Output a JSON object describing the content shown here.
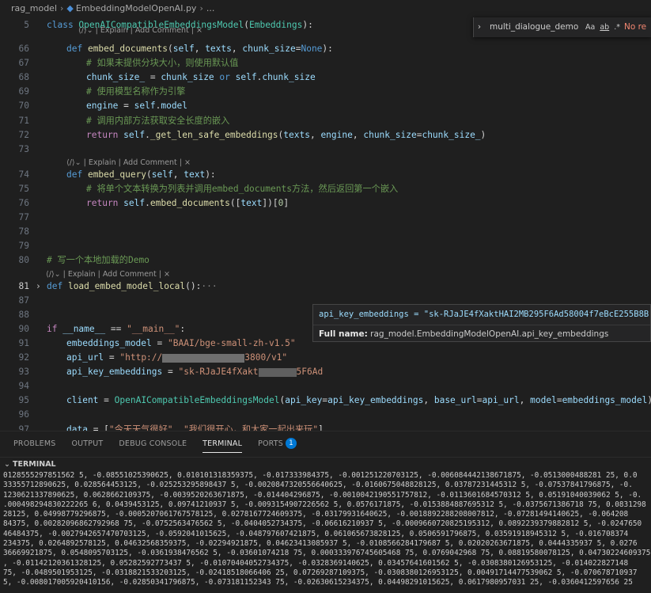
{
  "breadcrumb": {
    "folder": "rag_model",
    "file": "EmbeddingModelOpenAI.py",
    "rest": "..."
  },
  "find_widget": {
    "query": "multi_dialogue_demo",
    "match_case": "Aa",
    "whole_word": "ab",
    "regex": ".*",
    "result": "No re"
  },
  "codelens": {
    "top": "| Explain | Add Comment | ×",
    "l74": "| Explain | Add Comment | ×",
    "l81": "| Explain | Add Comment | ×"
  },
  "code": {
    "l5": [
      "5",
      "class ",
      "OpenAICompatibleEmbeddingsModel",
      "(",
      "Embeddings",
      "):"
    ],
    "l66": [
      "66",
      "def ",
      "embed_documents",
      "(",
      "self",
      ", ",
      "texts",
      ", ",
      "chunk_size",
      "=",
      "None",
      "):"
    ],
    "l67": [
      "67",
      "# 如果未提供分块大小，则使用默认值"
    ],
    "l68": [
      "68",
      "chunk_size_",
      " = ",
      "chunk_size",
      " or ",
      "self",
      ".",
      "chunk_size"
    ],
    "l69": [
      "69",
      "# 使用模型名称作为引擎"
    ],
    "l70": [
      "70",
      "engine",
      " = ",
      "self",
      ".",
      "model"
    ],
    "l71": [
      "71",
      "# 调用内部方法获取安全长度的嵌入"
    ],
    "l72": [
      "72",
      "return ",
      "self",
      ".",
      "_get_len_safe_embeddings",
      "(",
      "texts",
      ", ",
      "engine",
      ", ",
      "chunk_size",
      "=",
      "chunk_size_",
      ")"
    ],
    "l73": [
      "73"
    ],
    "l74": [
      "74",
      "def ",
      "embed_query",
      "(",
      "self",
      ", ",
      "text",
      "):"
    ],
    "l75": [
      "75",
      "# 将单个文本转换为列表并调用embed_documents方法，然后返回第一个嵌入"
    ],
    "l76": [
      "76",
      "return ",
      "self",
      ".",
      "embed_documents",
      "([",
      "text",
      "])[",
      "0",
      "]"
    ],
    "l77": [
      "77"
    ],
    "l78": [
      "78"
    ],
    "l79": [
      "79"
    ],
    "l80": [
      "80",
      "# 写一个本地加载的Demo"
    ],
    "l81": [
      "81",
      "def ",
      "load_embed_model_local",
      "():",
      "···"
    ],
    "l87": [
      "87"
    ],
    "l88": [
      "88"
    ],
    "l90": [
      "90",
      "if ",
      "__name__",
      " == ",
      "\"__main__\"",
      ":"
    ],
    "l91": [
      "91",
      "embeddings_model",
      " = ",
      "\"BAAI/bge-small-zh-v1.5\""
    ],
    "l92": [
      "92",
      "api_url",
      " = ",
      "\"http://",
      "3800/v1\""
    ],
    "l93": [
      "93",
      "api_key_embeddings",
      " = ",
      "\"sk-RJaJE4fXakt",
      "5F6Ad"
    ],
    "l94": [
      "94"
    ],
    "l95": [
      "95",
      "client",
      " = ",
      "OpenAICompatibleEmbeddingsModel",
      "(",
      "api_key",
      "=",
      "api_key_embeddings",
      ", ",
      "base_url",
      "=",
      "api_url",
      ", ",
      "model",
      "=",
      "embeddings_model",
      ")"
    ],
    "l96": [
      "96"
    ],
    "l97": [
      "97",
      "data",
      " = [",
      "\"今天天气很好\"",
      ", ",
      "\"我们很开心，和大家一起出来玩\"",
      "]"
    ],
    "l98": [
      "98"
    ],
    "l99": [
      "99",
      "embedding",
      " = ",
      "client",
      ".",
      "embed_query",
      "(",
      "data",
      "[",
      "0",
      "])  ",
      "# 注意这里应该是单个字符串而不是列表"
    ],
    "l100": [
      "100"
    ],
    "l101": [
      "101",
      "# print(embedding)"
    ]
  },
  "hover": {
    "signature": "api_key_embeddings = \"sk-RJaJE4fXaktHAI2MB295F6Ad58004f7eBcE255B8B",
    "full_label": "Full name:",
    "full_value": "rag_model.EmbeddingModelOpenAI.api_key_embeddings"
  },
  "panel": {
    "tabs": [
      "PROBLEMS",
      "OUTPUT",
      "DEBUG CONSOLE",
      "TERMINAL",
      "PORTS"
    ],
    "active_tab": "TERMINAL",
    "ports_badge": "1",
    "section": "TERMINAL"
  },
  "terminal_lines": [
    "0128555297851562 5, -0.08551025390625, 0.010101318359375, -0.017333984375, -0.001251220703125, -0.006084442138671875, -0.0513000488281 25, 0.0",
    "33355712890625, 0.028564453125, -0.025253295898437 5, -0.0020847320556640625, -0.0160675048828125, 0.03787231445312 5, -0.07537841796875, -0.",
    "1230621337890625, 0.0628662109375, -0.0039520263671875, -0.014404296875, -0.0010042190551757812, -0.0113601684570312 5, 0.05191040039062 5, -0.",
    ".000498294830222265 6, 0.0439453125, 0.09741210937 5, -0.0093154907226562 5, 0.0576171875, -0.0153884887695312 5, -0.0375671386718 75, 0.0831298",
    "28125, 0.04998779296875, -0.0005207061767578125, 0.0278167724609375, -0.03179931640625, -0.0018892288208007812, -0.07281494140625, -0.064208",
    "84375, 0.00282096862792968 75, -0.0752563476562 5, -0.0404052734375, -0.06616210937 5, -0.0009660720825195312, 0.0892239379882812 5, -0.0247650",
    "46484375, -0.0027942657470703125, -0.0592041015625, -0.048797607421875, 0.061065673828125, 0.0506591796875, 0.03591918945312 5, -0.016708374",
    "234375, 0.0264892578125, 0.04632568359375, -0.02294921875, 0.04623413085937 5, -0.0108566284179687 5, 0.02020263671875, 0.0444335937 5, 0.0276",
    "36669921875, 0.0548095703125, -0.0361938476562 5, -0.03601074218 75, 0.000333976745605468 75, 0.0769042968 75, 0.08819580078125, 0.04730224609375",
    ", -0.01142120361328125, 0.05282592773437 5, -0.01070404052734375, -0.0328369140625, 0.03457641601562 5, -0.0308380126953125, -0.014022827148",
    "75, -0.0489501953125, -0.0318821533203125, -0.02418518066406 25, 0.07269287109375, -0.0308380126953125, 0.00491714477539062 5, -0.070678710937",
    "5, -0.008017005920410156, -0.02850341796875, -0.073181152343 75, -0.02630615234375, 0.04498291015625, 0.0617980957031 25, -0.0360412597656 25"
  ]
}
